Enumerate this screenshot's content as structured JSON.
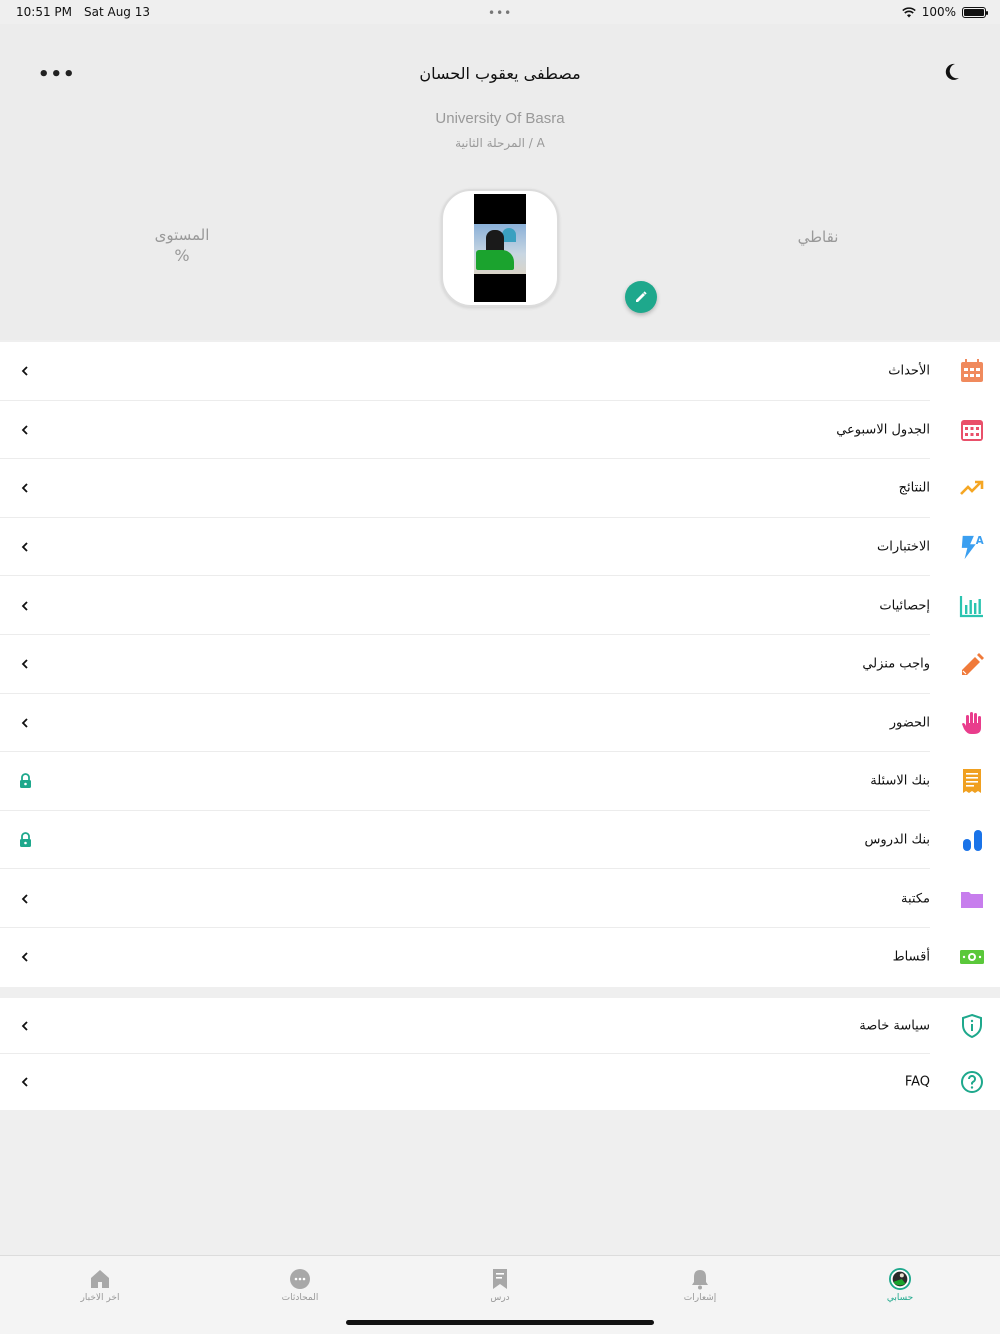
{
  "status_bar": {
    "time": "10:51 PM",
    "date": "Sat Aug 13",
    "dots": "•••",
    "battery_text": "100%"
  },
  "header": {
    "user_name": "مصطفى يعقوب الحسان",
    "university": "University Of Basra",
    "stage": "المرحلة الثانية / A",
    "level_label": "المستوى",
    "level_value": "%",
    "points_label": "نقاطي",
    "menu_icon": "more-dots-icon",
    "theme_icon": "moon-icon"
  },
  "menu": {
    "items": [
      {
        "label": "الأحداث",
        "icon": "calendar-icon",
        "trailing": "chevron",
        "color": "#f08a5d"
      },
      {
        "label": "الجدول الاسبوعي",
        "icon": "calendar-grid-icon",
        "trailing": "chevron",
        "color": "#e9506a"
      },
      {
        "label": "النتائج",
        "icon": "trending-up-icon",
        "trailing": "chevron",
        "color": "#f5a623"
      },
      {
        "label": "الاختبارات",
        "icon": "quiz-bolt-icon",
        "trailing": "chevron",
        "color": "#3b9ff0"
      },
      {
        "label": "إحصائيات",
        "icon": "bar-chart-icon",
        "trailing": "chevron",
        "color": "#2bc4b0"
      },
      {
        "label": "واجب منزلي",
        "icon": "pencil-icon",
        "trailing": "chevron",
        "color": "#f07a3a"
      },
      {
        "label": "الحضور",
        "icon": "hand-icon",
        "trailing": "chevron",
        "color": "#e93d8c"
      },
      {
        "label": "بنك الاسئلة",
        "icon": "receipt-icon",
        "trailing": "lock",
        "color": "#f0a020"
      },
      {
        "label": "بنك الدروس",
        "icon": "bars-icon",
        "trailing": "lock",
        "color": "#1a73e8"
      },
      {
        "label": "مكتبة",
        "icon": "folder-icon",
        "trailing": "chevron",
        "color": "#c77ded"
      },
      {
        "label": "أقساط",
        "icon": "money-icon",
        "trailing": "chevron",
        "color": "#5ac83a"
      }
    ]
  },
  "menu_secondary": {
    "items": [
      {
        "label": "سياسة خاصة",
        "icon": "shield-info-icon",
        "trailing": "chevron",
        "color": "#1ea88c"
      },
      {
        "label": "FAQ",
        "icon": "help-circle-icon",
        "trailing": "chevron",
        "color": "#1ea88c"
      }
    ]
  },
  "tabbar": {
    "tabs": [
      {
        "label": "اخر الاخبار",
        "icon": "home-icon"
      },
      {
        "label": "المحادثات",
        "icon": "chat-icon"
      },
      {
        "label": "درس",
        "icon": "bookmark-icon"
      },
      {
        "label": "إشعارات",
        "icon": "bell-icon"
      },
      {
        "label": "حسابي",
        "icon": "profile-avatar-icon",
        "active": true
      }
    ]
  },
  "colors": {
    "accent": "#1ea88c",
    "lock": "#1ea88c",
    "header_bg": "#ececec"
  }
}
